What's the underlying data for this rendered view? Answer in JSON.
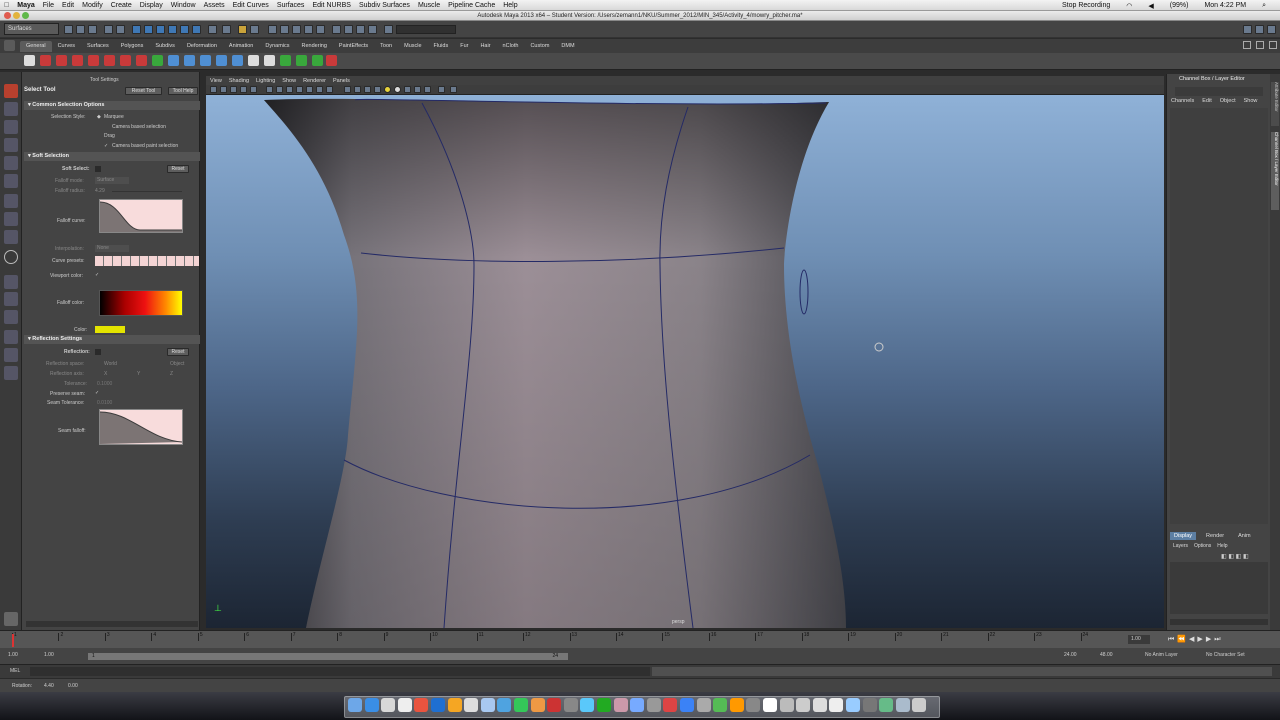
{
  "macmenu": {
    "apple": "",
    "app": "Maya",
    "items": [
      "File",
      "Edit",
      "Modify",
      "Create",
      "Display",
      "Window",
      "Assets",
      "Edit Curves",
      "Surfaces",
      "Edit NURBS",
      "Subdiv Surfaces",
      "Muscle",
      "Pipeline Cache",
      "Help"
    ],
    "status": {
      "battery": "(99%)",
      "clock": "Mon 4:22 PM",
      "recording": "Stop Recording"
    }
  },
  "window_title": "Autodesk Maya 2013 x64 – Student Version: /Users/zemann1/NKU/Summer_2012/MIN_345/Activity_4/mowry_pitcher.ma*",
  "mode_select": "Surfaces",
  "shelf_tabs": [
    "General",
    "Curves",
    "Surfaces",
    "Polygons",
    "Subdivs",
    "Deformation",
    "Animation",
    "Dynamics",
    "Rendering",
    "PaintEffects",
    "Toon",
    "Muscle",
    "Fluids",
    "Fur",
    "Hair",
    "nCloth",
    "Custom",
    "DMM"
  ],
  "tool_settings": {
    "header": "Tool Settings",
    "tool_name": "Select Tool",
    "reset_tool": "Reset Tool",
    "tool_help": "Tool Help",
    "common": {
      "title": "Common Selection Options",
      "selection_style_label": "Selection Style:",
      "marquee": "Marquee",
      "camera_based": "Camera based selection",
      "drag": "Drag",
      "camera_paint": "Camera based paint selection"
    },
    "soft": {
      "title": "Soft Selection",
      "soft_select_label": "Soft Select:",
      "reset": "Reset",
      "falloff_mode_label": "Falloff mode:",
      "falloff_mode_value": "Surface",
      "falloff_radius_label": "Falloff radius:",
      "falloff_radius_value": "4.29",
      "falloff_curve_label": "Falloff curve:",
      "interpolation_label": "Interpolation:",
      "interpolation_value": "None",
      "curve_presets_label": "Curve presets:",
      "viewport_color_label": "Viewport color:",
      "falloff_color_label": "Falloff color:",
      "color_label": "Color:"
    },
    "reflection": {
      "title": "Reflection Settings",
      "reflection_label": "Reflection:",
      "reset": "Reset",
      "space_label": "Reflection space:",
      "world": "World",
      "object": "Object",
      "axis_label": "Reflection axis:",
      "x": "X",
      "y": "Y",
      "z": "Z",
      "tolerance_label": "Tolerance:",
      "tolerance_value": "0.1000",
      "preserve_seam_label": "Preserve seam:",
      "seam_tolerance_label": "Seam Tolerance:",
      "seam_tolerance_value": "0.0100",
      "seam_falloff_label": "Seam falloff:"
    }
  },
  "viewport": {
    "menus": [
      "View",
      "Shading",
      "Lighting",
      "Show",
      "Renderer",
      "Panels"
    ],
    "camera_label": "persp"
  },
  "channel_box": {
    "title": "Channel Box / Layer Editor",
    "menus": [
      "Channels",
      "Edit",
      "Object",
      "Show"
    ],
    "layer_tabs": [
      "Display",
      "Render",
      "Anim"
    ],
    "layer_menus": [
      "Layers",
      "Options",
      "Help"
    ],
    "side_tabs": [
      "Attribute Editor",
      "Channel Box / Layer Editor"
    ]
  },
  "timeline": {
    "ticks": [
      "1",
      "2",
      "3",
      "4",
      "5",
      "6",
      "7",
      "8",
      "9",
      "10",
      "11",
      "12",
      "13",
      "14",
      "15",
      "16",
      "17",
      "18",
      "19",
      "20",
      "21",
      "22",
      "23",
      "24"
    ],
    "current_frame": "1.00"
  },
  "range": {
    "start": "1.00",
    "playback_start": "1.00",
    "range_start_marker": "1",
    "range_end_marker": "24",
    "playback_end": "24.00",
    "end": "48.00",
    "anim_layer": "No Anim Layer",
    "char_set": "No Character Set"
  },
  "mel": {
    "label": "MEL"
  },
  "help_line": {
    "label": "Rotation:",
    "v1": "4.40",
    "v2": "0.00"
  },
  "colors": {
    "accent": "#5d7fa3",
    "falloff_color": "#e4e400",
    "selected_tool": "#b8402e"
  }
}
